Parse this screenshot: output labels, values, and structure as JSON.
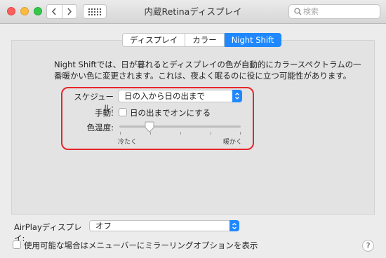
{
  "window": {
    "title": "内蔵Retinaディスプレイ"
  },
  "search": {
    "placeholder": "検索"
  },
  "tabs": [
    {
      "label": "ディスプレイ",
      "active": false
    },
    {
      "label": "カラー",
      "active": false
    },
    {
      "label": "Night Shift",
      "active": true
    }
  ],
  "night_shift": {
    "description": "Night Shiftでは、日が暮れるとディスプレイの色が自動的にカラースペクトラムの一番暖かい色に変更されます。これは、夜よく眠るのに役に立つ可能性があります。",
    "schedule_label": "スケジュール:",
    "schedule_value": "日の入から日の出まで",
    "manual_label": "手動:",
    "manual_checkbox_label": "日の出までオンにする",
    "manual_checked": false,
    "temperature_label": "色温度:",
    "temperature_less": "冷たく",
    "temperature_more": "暖かく",
    "temperature_level": 0.25
  },
  "airplay": {
    "label": "AirPlayディスプレイ:",
    "value": "オフ"
  },
  "mirror_option": {
    "label": "使用可能な場合はメニューバーにミラーリングオプションを表示",
    "checked": false
  },
  "help": {
    "label": "?"
  },
  "colors": {
    "accent": "#1f88ff",
    "highlight_box": "#e8242a"
  }
}
